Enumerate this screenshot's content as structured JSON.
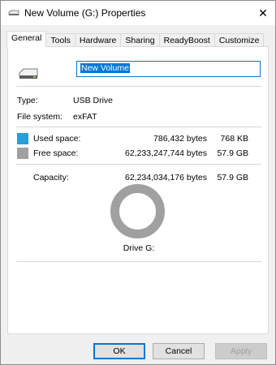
{
  "window": {
    "title": "New Volume (G:) Properties",
    "close_glyph": "✕"
  },
  "tabs": [
    {
      "label": "General",
      "active": true
    },
    {
      "label": "Tools"
    },
    {
      "label": "Hardware"
    },
    {
      "label": "Sharing"
    },
    {
      "label": "ReadyBoost"
    },
    {
      "label": "Customize"
    }
  ],
  "general": {
    "volume_name": "New Volume",
    "type_label": "Type:",
    "type_value": "USB Drive",
    "fs_label": "File system:",
    "fs_value": "exFAT",
    "used": {
      "label": "Used space:",
      "bytes": "786,432 bytes",
      "size": "768 KB",
      "color": "#26a0da"
    },
    "free": {
      "label": "Free space:",
      "bytes": "62,233,247,744 bytes",
      "size": "57.9 GB",
      "color": "#a0a0a0"
    },
    "capacity": {
      "label": "Capacity:",
      "bytes": "62,234,034,176 bytes",
      "size": "57.9 GB"
    },
    "used_fraction": 1.26e-05,
    "drive_label": "Drive G:"
  },
  "buttons": {
    "ok": "OK",
    "cancel": "Cancel",
    "apply": "Apply"
  }
}
